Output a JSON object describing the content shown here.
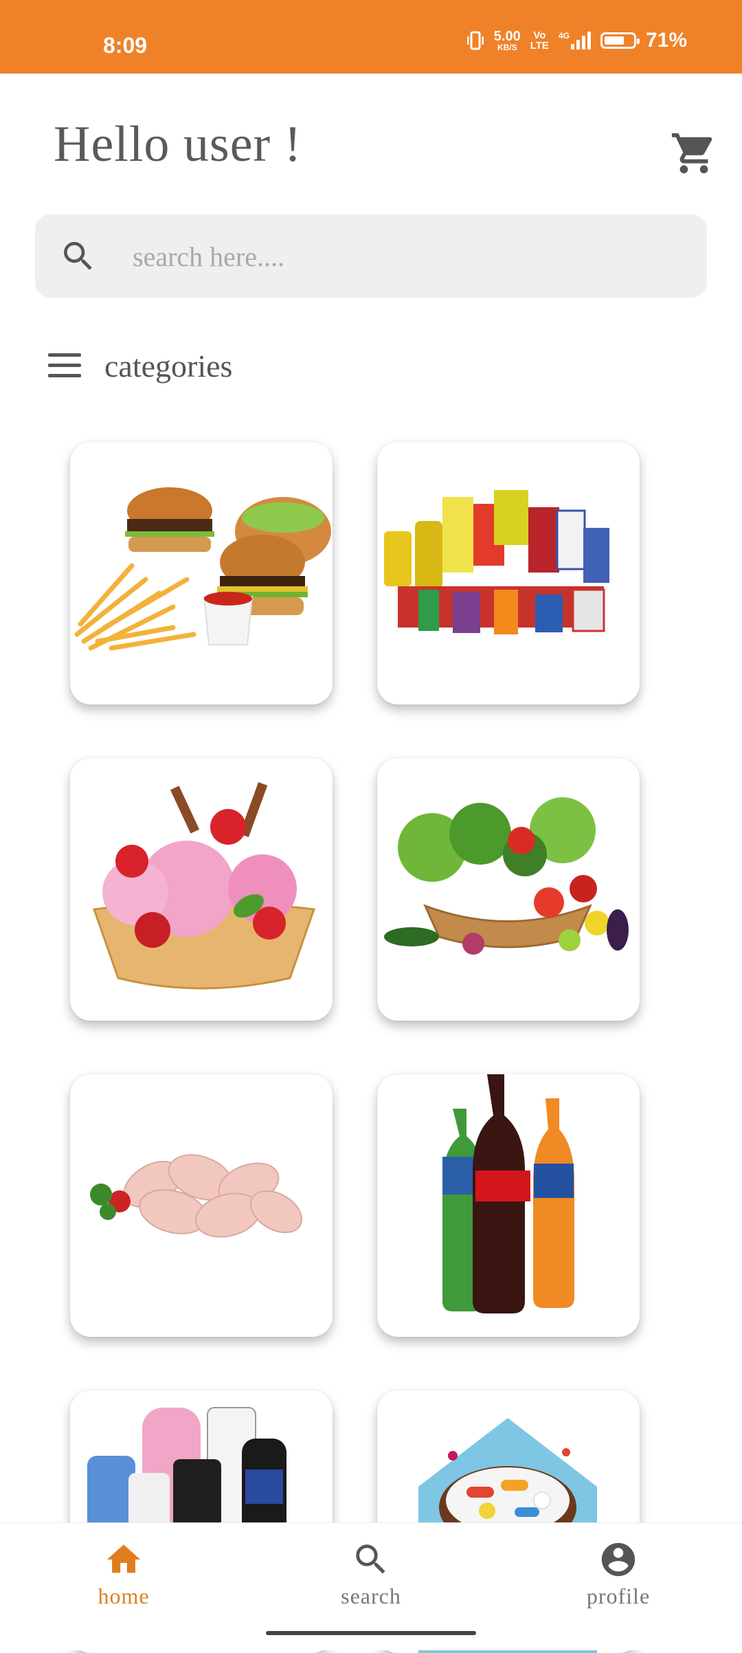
{
  "status_bar": {
    "time": "8:09",
    "net_speed_value": "5.00",
    "net_speed_unit": "KB/S",
    "volte_top": "Vo",
    "volte_bottom": "LTE",
    "network": "4G",
    "battery_percent": "71%",
    "battery_level": 0.71,
    "background_color": "#ef8228"
  },
  "header": {
    "greeting": "Hello  user !",
    "cart_icon": "shopping-cart-icon"
  },
  "search": {
    "placeholder": "search here....",
    "value": "",
    "icon": "search-icon"
  },
  "categories": {
    "title": "categories",
    "menu_icon": "hamburger-menu-icon",
    "items": [
      {
        "image": "fast-food-burgers-fries"
      },
      {
        "image": "grocery-packages"
      },
      {
        "image": "ice-cream-strawberries"
      },
      {
        "image": "vegetables-basket"
      },
      {
        "image": "chicken-drumsticks"
      },
      {
        "image": "soft-drink-bottles"
      },
      {
        "image": "personal-care-products"
      },
      {
        "image": "medicine-pills"
      }
    ]
  },
  "bottom_nav": {
    "items": [
      {
        "label": "home",
        "icon": "home-icon",
        "active": true
      },
      {
        "label": "search",
        "icon": "search-icon",
        "active": false
      },
      {
        "label": "profile",
        "icon": "profile-icon",
        "active": false
      }
    ],
    "active_color": "#e07d20"
  }
}
